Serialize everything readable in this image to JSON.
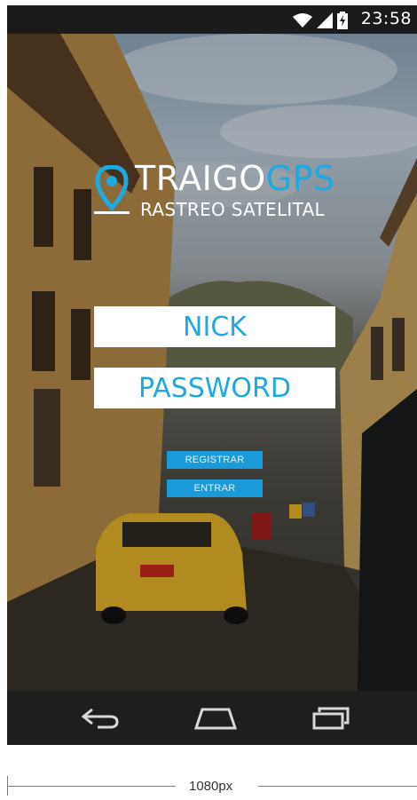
{
  "status_bar": {
    "time": "23:58",
    "icons": [
      "wifi-icon",
      "signal-icon",
      "battery-charging-icon"
    ]
  },
  "logo": {
    "brand_primary": "TRAIGO",
    "brand_accent": "GPS",
    "subtitle": "RASTREO SATELITAL",
    "accent_color": "#1ea9e1"
  },
  "form": {
    "nick_placeholder": "NICK",
    "password_placeholder": "PASSWORD",
    "register_label": "REGISTRAR",
    "login_label": "ENTRAR"
  },
  "nav_bar": {
    "icons": [
      "back-icon",
      "home-icon",
      "recent-apps-icon"
    ]
  },
  "measurement": {
    "label": "1080px"
  }
}
